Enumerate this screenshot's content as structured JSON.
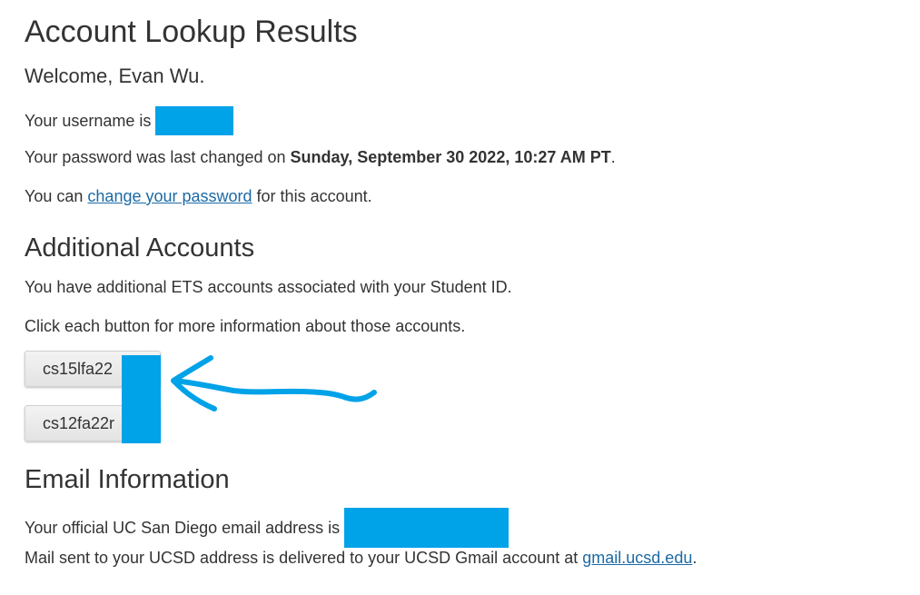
{
  "title": "Account Lookup Results",
  "welcome": "Welcome, Evan Wu.",
  "username": {
    "prefix": "Your username is"
  },
  "password": {
    "prefix": "Your password was last changed on",
    "date": "Sunday, September 30 2022, 10:27 AM PT",
    "suffix": "."
  },
  "change": {
    "prefix": "You can",
    "link": "change your password",
    "suffix": "for this account."
  },
  "additional": {
    "heading": "Additional Accounts",
    "text1": "You have additional ETS accounts associated with your Student ID.",
    "text2": "Click each button for more information about those accounts.",
    "buttons": [
      "cs15lfa22",
      "cs12fa22r"
    ]
  },
  "email": {
    "heading": "Email Information",
    "official_prefix": "Your official UC San Diego email address is",
    "mail_prefix": "Mail sent to your UCSD address is delivered to your UCSD Gmail account at",
    "mail_link": "gmail.ucsd.edu",
    "mail_suffix": "."
  },
  "colors": {
    "redaction": "#00a2e8",
    "link": "#1b6aa5",
    "text": "#333333"
  }
}
